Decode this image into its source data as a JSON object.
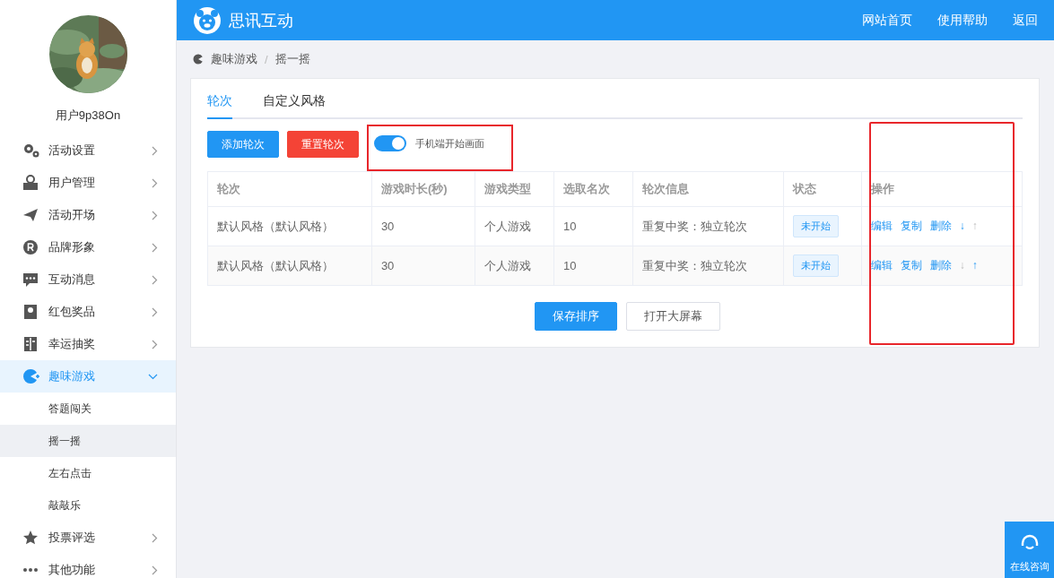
{
  "sidebar": {
    "username": "用户9p38On",
    "items": [
      {
        "label": "活动设置",
        "expanded": false,
        "selected": false
      },
      {
        "label": "用户管理",
        "expanded": false,
        "selected": false
      },
      {
        "label": "活动开场",
        "expanded": false,
        "selected": false
      },
      {
        "label": "品牌形象",
        "expanded": false,
        "selected": false
      },
      {
        "label": "互动消息",
        "expanded": false,
        "selected": false
      },
      {
        "label": "红包奖品",
        "expanded": false,
        "selected": false
      },
      {
        "label": "幸运抽奖",
        "expanded": false,
        "selected": false
      },
      {
        "label": "趣味游戏",
        "expanded": true,
        "selected": true,
        "children": [
          {
            "label": "答题闯关",
            "selected": false
          },
          {
            "label": "摇一摇",
            "selected": true
          },
          {
            "label": "左右点击",
            "selected": false
          },
          {
            "label": "敲敲乐",
            "selected": false
          }
        ]
      },
      {
        "label": "投票评选",
        "expanded": false,
        "selected": false
      },
      {
        "label": "其他功能",
        "expanded": false,
        "selected": false
      }
    ]
  },
  "header": {
    "brand": "思讯互动",
    "links": [
      "网站首页",
      "使用帮助",
      "返回"
    ]
  },
  "breadcrumb": {
    "separator": "/",
    "items": [
      "趣味游戏",
      "摇一摇"
    ]
  },
  "tabs": [
    {
      "label": "轮次",
      "selected": true
    },
    {
      "label": "自定义风格",
      "selected": false
    }
  ],
  "toolbar": {
    "buttons": [
      {
        "label": "添加轮次",
        "kind": "primary"
      },
      {
        "label": "重置轮次",
        "kind": "danger"
      }
    ],
    "toggle": {
      "label": "手机端开始画面",
      "on": true,
      "highlighted": true
    }
  },
  "table": {
    "columns": [
      {
        "label": "轮次",
        "highlighted": false
      },
      {
        "label": "游戏时长(秒)",
        "highlighted": false
      },
      {
        "label": "游戏类型",
        "highlighted": false
      },
      {
        "label": "选取名次",
        "highlighted": false
      },
      {
        "label": "轮次信息",
        "highlighted": false
      },
      {
        "label": "状态",
        "highlighted": false
      },
      {
        "label": "操作",
        "highlighted": true
      }
    ],
    "rows": [
      {
        "cells": [
          "默认风格（默认风格）",
          "30",
          "个人游戏",
          "10",
          "重复中奖：独立轮次"
        ],
        "status": "未开始",
        "actions": [
          "编辑",
          "复制",
          "删除"
        ],
        "move_down": {
          "label": "↓",
          "disabled": false
        },
        "move_up": {
          "label": "↑",
          "disabled": true
        }
      },
      {
        "cells": [
          "默认风格（默认风格）",
          "30",
          "个人游戏",
          "10",
          "重复中奖：独立轮次"
        ],
        "status": "未开始",
        "actions": [
          "编辑",
          "复制",
          "删除"
        ],
        "move_down": {
          "label": "↓",
          "disabled": true
        },
        "move_up": {
          "label": "↑",
          "disabled": false
        }
      }
    ]
  },
  "footer_buttons": [
    {
      "label": "保存排序",
      "kind": "primary"
    },
    {
      "label": "打开大屏幕",
      "kind": "default"
    }
  ],
  "chat_button": {
    "label": "在线咨询"
  }
}
